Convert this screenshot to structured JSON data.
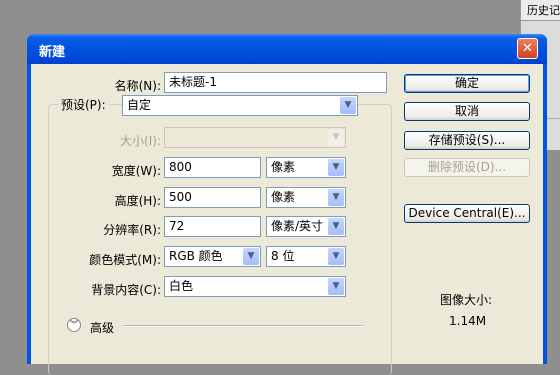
{
  "background_panel": {
    "header": "历史记"
  },
  "dialog": {
    "title": "新建",
    "close_glyph": "✕",
    "name": {
      "label": "名称(N):",
      "value": "未标题-1"
    },
    "preset": {
      "label": "预设(P):",
      "value": "自定"
    },
    "size": {
      "label": "大小(I):",
      "value": ""
    },
    "width": {
      "label": "宽度(W):",
      "value": "800",
      "unit": "像素"
    },
    "height": {
      "label": "高度(H):",
      "value": "500",
      "unit": "像素"
    },
    "resolution": {
      "label": "分辨率(R):",
      "value": "72",
      "unit": "像素/英寸"
    },
    "color_mode": {
      "label": "颜色模式(M):",
      "value": "RGB 颜色",
      "depth": "8 位"
    },
    "background": {
      "label": "背景内容(C):",
      "value": "白色"
    },
    "advanced": {
      "label": "高级"
    },
    "buttons": {
      "ok": "确定",
      "cancel": "取消",
      "save_preset": "存储预设(S)...",
      "delete_preset": "删除预设(D)...",
      "device_central": "Device Central(E)..."
    },
    "image_size": {
      "label": "图像大小:",
      "value": "1.14M"
    }
  },
  "icons": {
    "dropdown": "chevron-down-icon",
    "advanced": "double-chevron-down-icon"
  },
  "colors": {
    "titlebar": "#0054e3",
    "client": "#ece9d8",
    "close": "#d3401d"
  }
}
